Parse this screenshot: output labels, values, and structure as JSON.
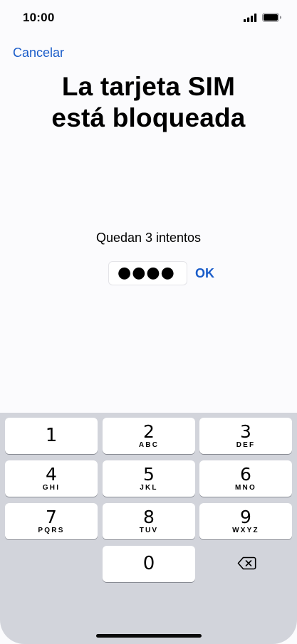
{
  "status_bar": {
    "time": "10:00",
    "signal_icon": "signal-bars-icon",
    "battery_icon": "battery-full-icon"
  },
  "header": {
    "cancel_label": "Cancelar"
  },
  "main": {
    "title_line1": "La tarjeta SIM",
    "title_line2": "está bloqueada",
    "attempts_text": "Quedan 3 intentos",
    "pin_value": "●●●●",
    "ok_label": "OK"
  },
  "colors": {
    "accent": "#1a5cc9",
    "keypad_bg": "#d2d4db"
  },
  "keypad": {
    "keys": [
      {
        "digit": "1",
        "letters": ""
      },
      {
        "digit": "2",
        "letters": "ABC"
      },
      {
        "digit": "3",
        "letters": "DEF"
      },
      {
        "digit": "4",
        "letters": "GHI"
      },
      {
        "digit": "5",
        "letters": "JKL"
      },
      {
        "digit": "6",
        "letters": "MNO"
      },
      {
        "digit": "7",
        "letters": "PQRS"
      },
      {
        "digit": "8",
        "letters": "TUV"
      },
      {
        "digit": "9",
        "letters": "WXYZ"
      },
      {
        "digit": "0",
        "letters": ""
      }
    ],
    "delete_icon": "backspace-icon"
  }
}
